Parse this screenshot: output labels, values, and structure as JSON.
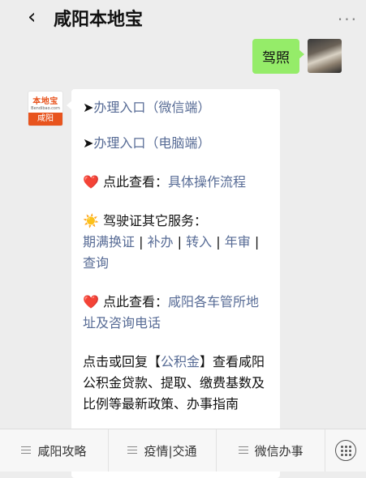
{
  "header": {
    "title": "咸阳本地宝",
    "back_glyph": "‹",
    "more_glyph": "···"
  },
  "sent": {
    "text": "驾照"
  },
  "bot": {
    "logo_text": "本地宝",
    "logo_url": "Bendibao.com",
    "logo_city": "咸阳"
  },
  "message": {
    "arrow": "➤",
    "entry_wechat": "办理入口（微信端）",
    "entry_pc": "办理入口（电脑端）",
    "heart": "❤️",
    "check_prefix": " 点此查看：",
    "check_flow_link": "具体操作流程",
    "sun": "☀️",
    "other_services": " 驾驶证其它服务：",
    "services": [
      "期满换证",
      "补办",
      "转入",
      "年审",
      "查询"
    ],
    "sep": " | ",
    "check_prefix2": " 点此查看：",
    "dmv_link": "咸阳各车管所地址及咨询电话",
    "reply_pre": "点击或回复【",
    "reply_link": "公积金",
    "reply_post": "】查看咸阳公积金贷款、提取、缴费基数及比例等最新政策、办事指南"
  },
  "menu": {
    "items": [
      "咸阳攻略",
      "疫情|交通",
      "微信办事"
    ]
  }
}
